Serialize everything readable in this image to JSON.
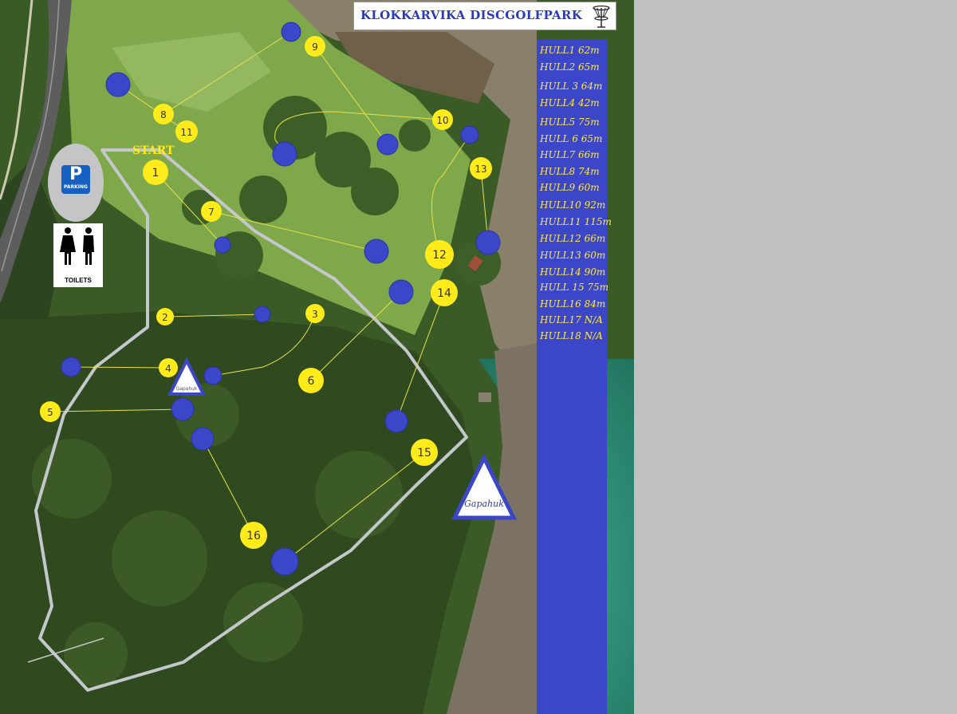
{
  "title": "KLOKKARVIKA DISCGOLFPARK",
  "start_label": "START",
  "parking": {
    "symbol": "P",
    "label": "PARKING"
  },
  "toilets": {
    "label": "TOILETS"
  },
  "shelters": [
    {
      "label": "Gapahuk",
      "size": "small"
    },
    {
      "label": "Gapahuk",
      "size": "large"
    }
  ],
  "holes": [
    {
      "label": "HULL1 62m"
    },
    {
      "label": "HULL2 65m"
    },
    {
      "label": "HULL 3 64m"
    },
    {
      "label": "HULL4 42m"
    },
    {
      "label": "HULL5 75m"
    },
    {
      "label": "HULL 6 65m"
    },
    {
      "label": "HULL7 66m"
    },
    {
      "label": "HULL8 74m"
    },
    {
      "label": "HULL9 60m"
    },
    {
      "label": "HULL10 92m"
    },
    {
      "label": "HULL11 115m"
    },
    {
      "label": "HULL12 66m"
    },
    {
      "label": "HULL13 60m"
    },
    {
      "label": "HULL14 90m"
    },
    {
      "label": "HULL 15 75m"
    },
    {
      "label": "HULL16 84m"
    },
    {
      "label": "HULL17 N/A"
    },
    {
      "label": "HULL18 N/A"
    }
  ],
  "tees": [
    "1",
    "2",
    "3",
    "4",
    "5",
    "6",
    "7",
    "8",
    "9",
    "10",
    "11",
    "12",
    "13",
    "14",
    "15",
    "16"
  ],
  "colors": {
    "tee": "#ffeb1a",
    "basket": "#3b46c8",
    "trail": "#c4c7cc",
    "sidebar": "#3b46c8",
    "sidebar_text": "#ffe94a",
    "title_text": "#2b3bb8",
    "sea": "#2f8f73",
    "forest": "#2f4a1e",
    "meadow": "#7fa84a"
  },
  "icons": [
    "disc-golf-basket-icon",
    "parking-icon",
    "toilet-icon",
    "shelter-triangle-icon"
  ]
}
